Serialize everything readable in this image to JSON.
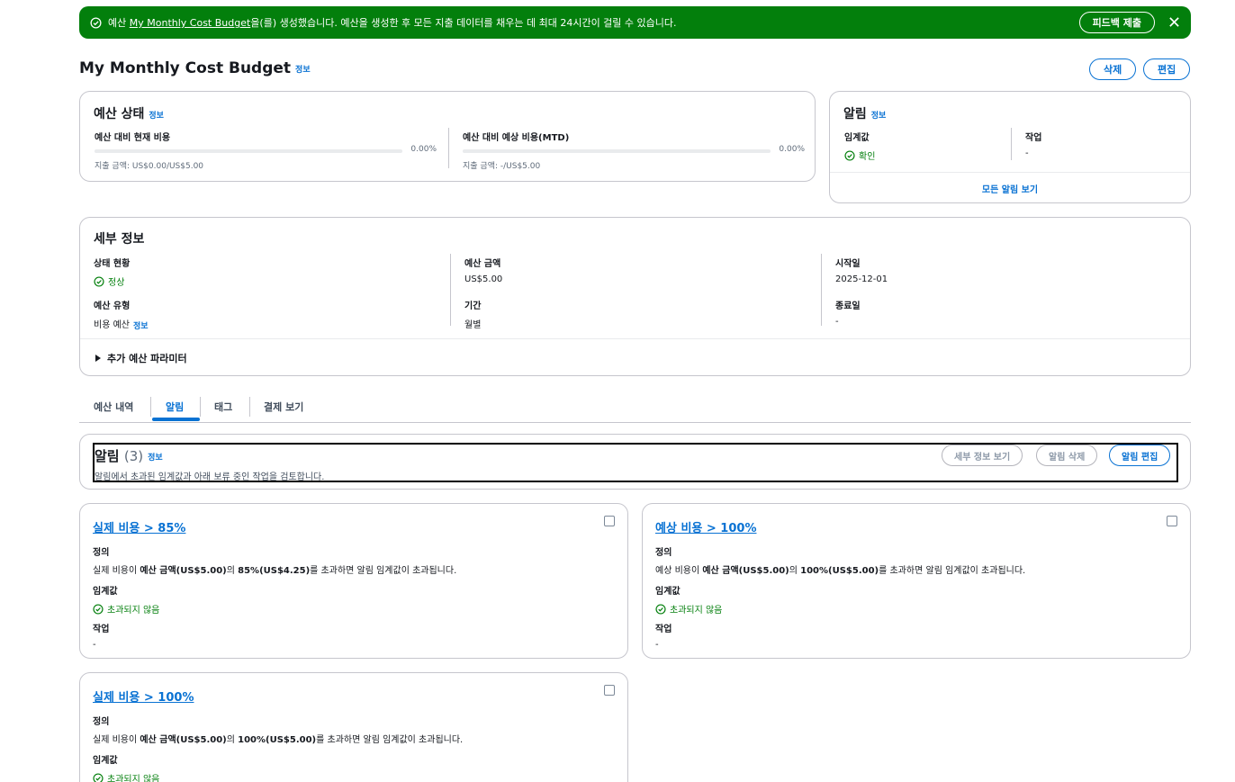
{
  "flash": {
    "prefix": "예산 ",
    "link": "My Monthly Cost Budget",
    "suffix": "을(를) 생성했습니다. 예산을 생성한 후 모든 지출 데이터를 채우는 데 최대 24시간이 걸릴 수 있습니다.",
    "feedback_button": "피드백 제출",
    "color": "#037f0c"
  },
  "page": {
    "title": "My Monthly Cost Budget",
    "info": "정보",
    "delete_button": "삭제",
    "edit_button": "편집"
  },
  "budget_status": {
    "title": "예산 상태",
    "info": "정보",
    "current": {
      "label": "예산 대비 현재 비용",
      "percent": "0.00%",
      "progress": 0,
      "sub": "지출 금액: US$0.00/US$5.00"
    },
    "forecast": {
      "label": "예산 대비 예상 비용(MTD)",
      "percent": "0.00%",
      "progress": 0,
      "sub": "지출 금액: -/US$5.00"
    }
  },
  "alarm_summary": {
    "title": "알림",
    "info": "정보",
    "threshold_label": "임계값",
    "threshold_value": "확인",
    "action_label": "작업",
    "action_value": "-",
    "view_all": "모든 알림 보기"
  },
  "details": {
    "title": "세부 정보",
    "status_label": "상태 현황",
    "status_value": "정상",
    "amount_label": "예산 금액",
    "amount_value": "US$5.00",
    "start_label": "시작일",
    "start_value": "2025-12-01",
    "type_label": "예산 유형",
    "type_value": "비용 예산",
    "type_info": "정보",
    "period_label": "기간",
    "period_value": "월별",
    "end_label": "종료일",
    "end_value": "-",
    "expander": "추가 예산 파라미터"
  },
  "tabs": [
    "예산 내역",
    "알림",
    "태그",
    "결제 보기"
  ],
  "alarms": {
    "title": "알림",
    "count": "(3)",
    "info": "정보",
    "description": "알림에서 초과된 임계값과 아래 보류 중인 작업을 검토합니다.",
    "details_button": "세부 정보 보기",
    "delete_button": "알림 삭제",
    "edit_button": "알림 편집"
  },
  "alarm_cards": [
    {
      "title": "실제 비용 > 85%",
      "def_label": "정의",
      "def_pre": "실제 비용이 ",
      "def_b1": "예산 금액(US$5.00)",
      "def_mid": "의 ",
      "def_b2": "85%(US$4.25)",
      "def_post": "를 초과하면 알림 임계값이 초과됩니다.",
      "threshold_label": "임계값",
      "threshold_value": "초과되지 않음",
      "action_label": "작업",
      "action_value": "-"
    },
    {
      "title": "예상 비용 > 100%",
      "def_label": "정의",
      "def_pre": "예상 비용이 ",
      "def_b1": "예산 금액(US$5.00)",
      "def_mid": "의 ",
      "def_b2": "100%(US$5.00)",
      "def_post": "를 초과하면 알림 임계값이 초과됩니다.",
      "threshold_label": "임계값",
      "threshold_value": "초과되지 않음",
      "action_label": "작업",
      "action_value": "-"
    },
    {
      "title": "실제 비용 > 100%",
      "def_label": "정의",
      "def_pre": "실제 비용이 ",
      "def_b1": "예산 금액(US$5.00)",
      "def_mid": "의 ",
      "def_b2": "100%(US$5.00)",
      "def_post": "를 초과하면 알림 임계값이 초과됩니다.",
      "threshold_label": "임계값",
      "threshold_value": "초과되지 않음"
    }
  ]
}
